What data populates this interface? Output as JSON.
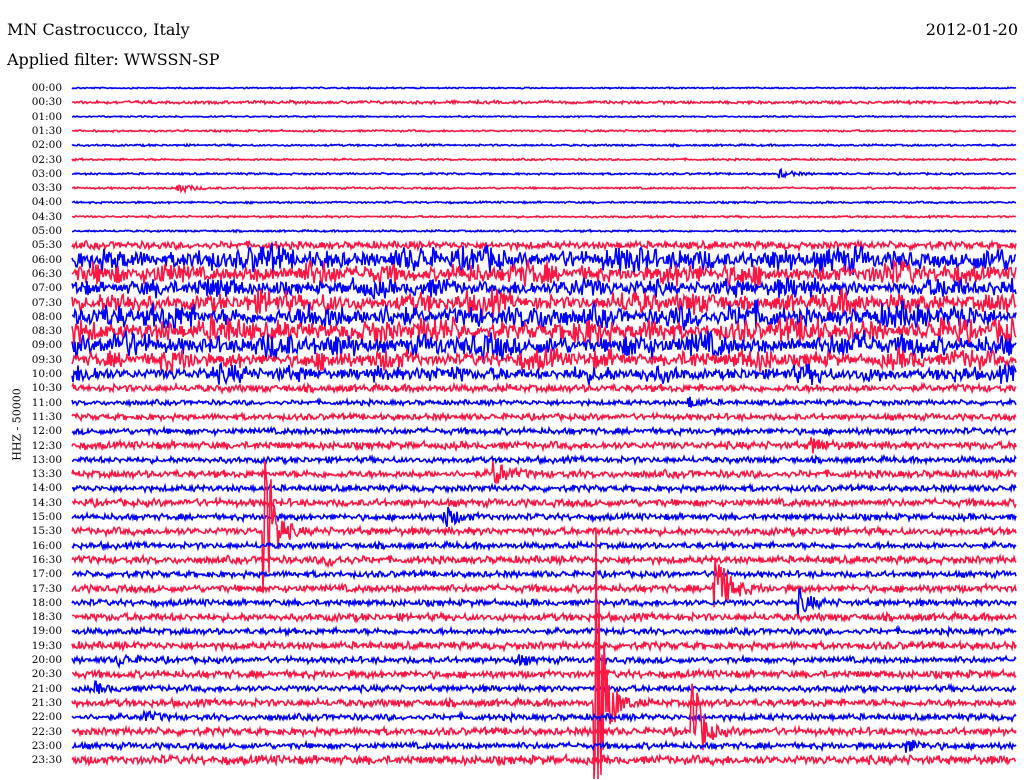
{
  "header": {
    "station": "MN Castrocucco, Italy",
    "date": "2012-01-20",
    "filter": "Applied filter: WWSSN-SP"
  },
  "chart_data": {
    "type": "line",
    "title": "MN Castrocucco, Italy",
    "ylabel": "HHZ - 50000",
    "minutes_per_row": 30,
    "colors": [
      "#0000ff",
      "#ff1744"
    ],
    "rows": [
      "00:00",
      "00:30",
      "01:00",
      "01:30",
      "02:00",
      "02:30",
      "03:00",
      "03:30",
      "04:00",
      "04:30",
      "05:00",
      "05:30",
      "06:00",
      "06:30",
      "07:00",
      "07:30",
      "08:00",
      "08:30",
      "09:00",
      "09:30",
      "10:00",
      "10:30",
      "11:00",
      "11:30",
      "12:00",
      "12:30",
      "13:00",
      "13:30",
      "14:00",
      "14:30",
      "15:00",
      "15:30",
      "16:00",
      "16:30",
      "17:00",
      "17:30",
      "18:00",
      "18:30",
      "19:00",
      "19:30",
      "20:00",
      "20:30",
      "21:00",
      "21:30",
      "22:00",
      "22:30",
      "23:00",
      "23:30"
    ],
    "noise_level": [
      0.6,
      1.2,
      0.6,
      0.8,
      0.8,
      0.8,
      0.8,
      0.8,
      0.8,
      0.8,
      0.8,
      3,
      9,
      8,
      7,
      8,
      9,
      9,
      9,
      7,
      6,
      3,
      2,
      2.5,
      2.5,
      3,
      2.5,
      3,
      2.5,
      3,
      2.5,
      3,
      2.5,
      3,
      2.5,
      3,
      2.5,
      3,
      2.5,
      3,
      2.5,
      3,
      2.5,
      3,
      2.5,
      3,
      2.5,
      3.5
    ],
    "events": [
      {
        "row": 6,
        "minute": 22.5,
        "amp": 4
      },
      {
        "row": 7,
        "minute": 3.3,
        "amp": 6
      },
      {
        "row": 22,
        "minute": 19.6,
        "amp": 5
      },
      {
        "row": 25,
        "minute": 23.5,
        "amp": 8
      },
      {
        "row": 27,
        "minute": 13.4,
        "amp": 14
      },
      {
        "row": 30,
        "minute": 11.8,
        "amp": 12
      },
      {
        "row": 31,
        "minute": 6.1,
        "amp": 120
      },
      {
        "row": 33,
        "minute": 8.1,
        "amp": 6
      },
      {
        "row": 35,
        "minute": 20.4,
        "amp": 40
      },
      {
        "row": 36,
        "minute": 23.1,
        "amp": 12
      },
      {
        "row": 40,
        "minute": 1.4,
        "amp": 6
      },
      {
        "row": 40,
        "minute": 14.1,
        "amp": 5
      },
      {
        "row": 42,
        "minute": 0.7,
        "amp": 5
      },
      {
        "row": 43,
        "minute": 16.6,
        "amp": 220
      },
      {
        "row": 44,
        "minute": 2.2,
        "amp": 6
      },
      {
        "row": 45,
        "minute": 19.7,
        "amp": 70
      },
      {
        "row": 46,
        "minute": 26.5,
        "amp": 7
      }
    ]
  }
}
